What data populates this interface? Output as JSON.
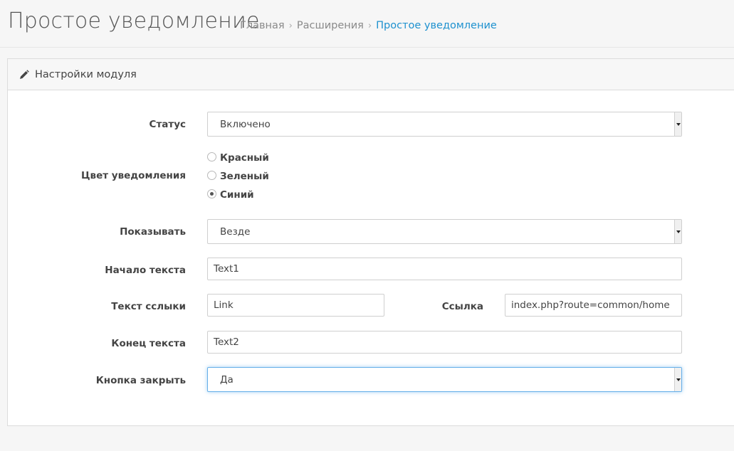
{
  "header": {
    "title": "Простое уведомление",
    "breadcrumbs": [
      {
        "label": "Главная"
      },
      {
        "label": "Расширения"
      },
      {
        "label": "Простое уведомление"
      }
    ],
    "separator": "›"
  },
  "panel": {
    "heading": "Настройки модуля",
    "heading_icon": "pencil-icon"
  },
  "form": {
    "status": {
      "label": "Статус",
      "value": "Включено"
    },
    "color": {
      "label": "Цвет уведомления",
      "options": [
        {
          "label": "Красный",
          "checked": false
        },
        {
          "label": "Зеленый",
          "checked": false
        },
        {
          "label": "Синий",
          "checked": true
        }
      ]
    },
    "show": {
      "label": "Показывать",
      "value": "Везде"
    },
    "text_start": {
      "label": "Начало текста",
      "value": "Text1"
    },
    "link_text": {
      "label": "Текст сслыки",
      "value": "Link"
    },
    "link": {
      "label": "Ссылка",
      "value": "index.php?route=common/home"
    },
    "text_end": {
      "label": "Конец текста",
      "value": "Text2"
    },
    "close_button": {
      "label": "Кнопка закрыть",
      "value": "Да"
    }
  }
}
